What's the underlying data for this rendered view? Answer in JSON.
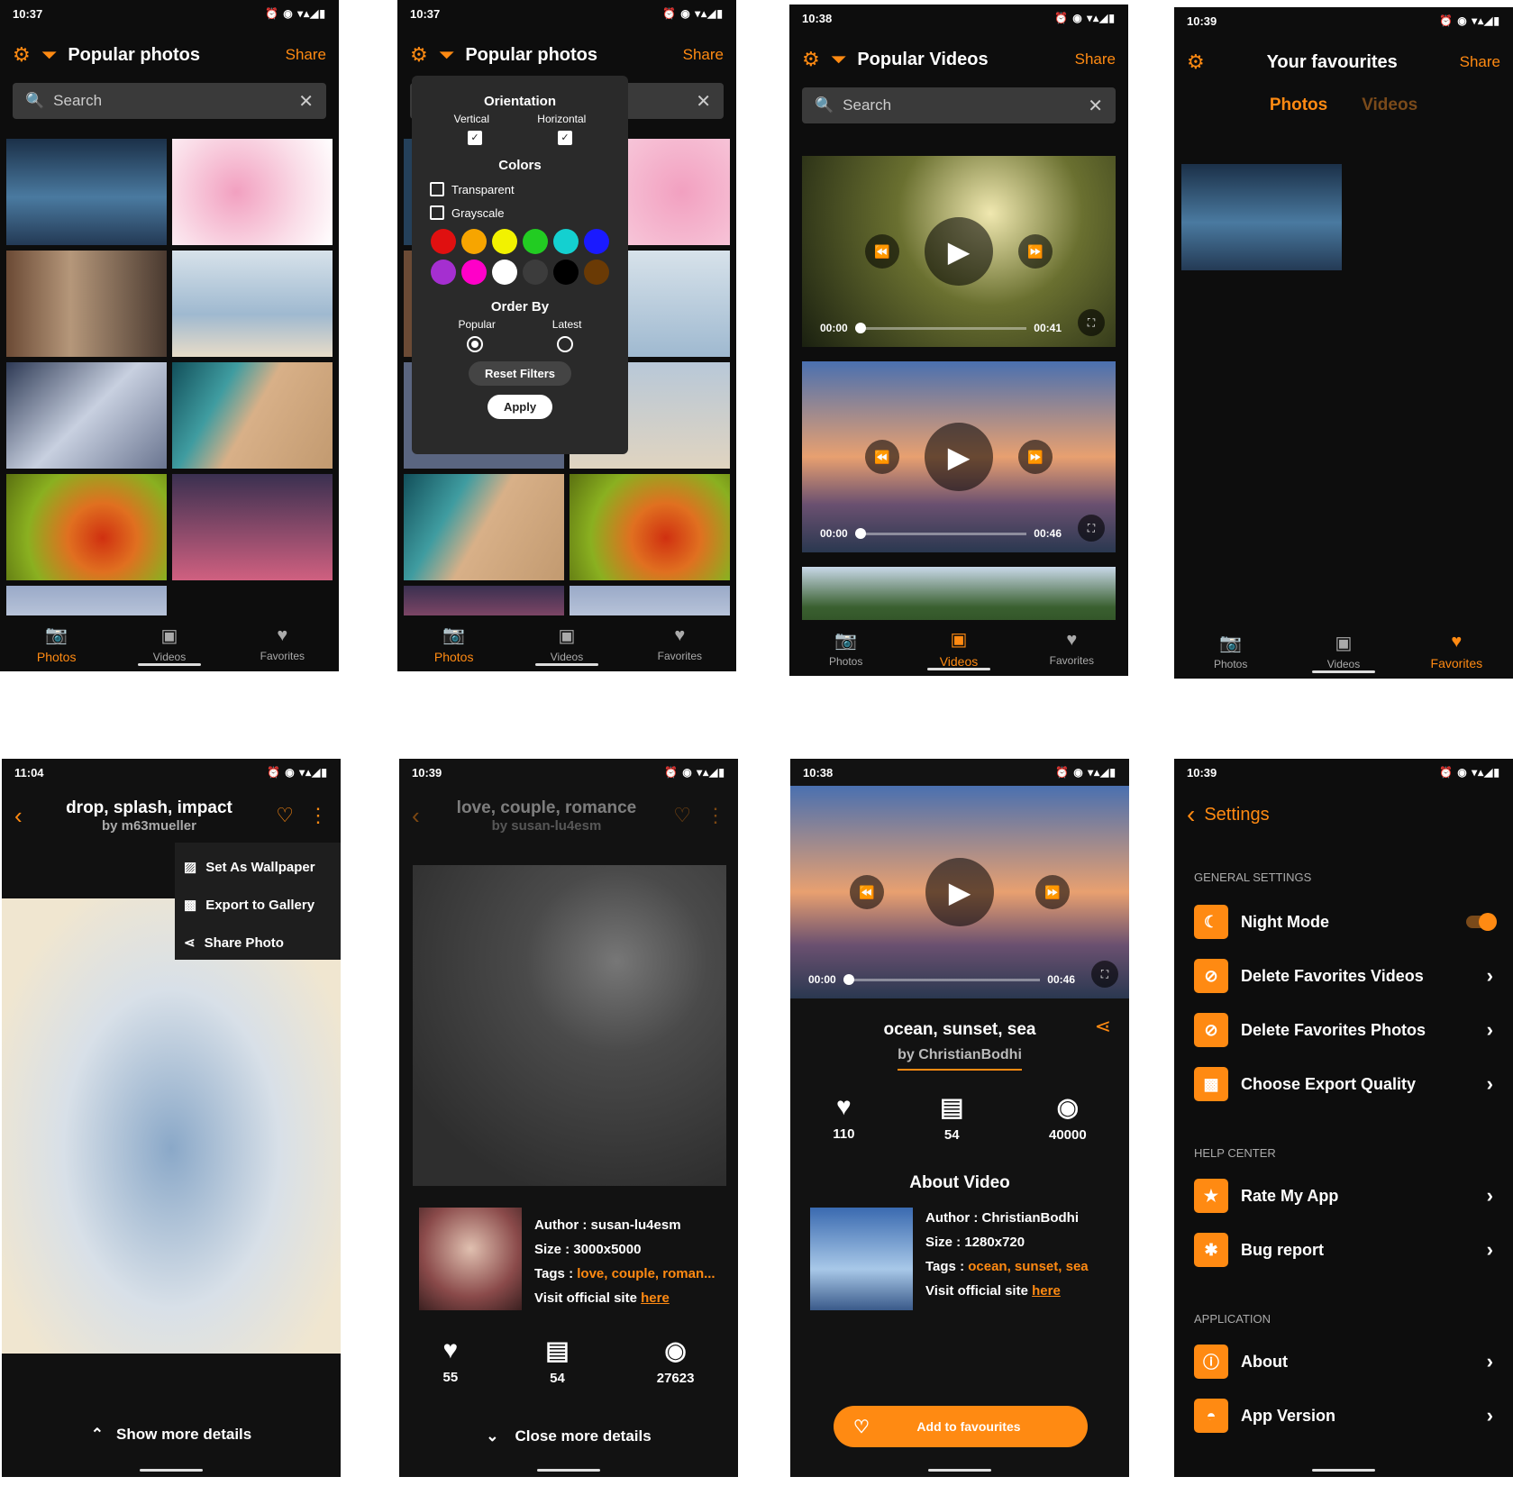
{
  "status": {
    "s1": "10:37",
    "s2": "10:37",
    "s3": "10:38",
    "s4": "10:39",
    "s5": "11:04",
    "s6": "10:39",
    "s7": "10:38",
    "s8": "10:39",
    "right": "⏰ ◉ ▾▴◢▮"
  },
  "colors": {
    "accent": "#ff8a12",
    "bg": "#0d0d0d"
  },
  "common": {
    "share": "Share",
    "search_placeholder": "Search"
  },
  "nav": {
    "photos": "Photos",
    "videos": "Videos",
    "favorites": "Favorites"
  },
  "screen1": {
    "title": "Popular photos"
  },
  "screen2": {
    "title": "Popular photos",
    "orientation": "Orientation",
    "vertical": "Vertical",
    "horizontal": "Horizontal",
    "colors_label": "Colors",
    "transparent": "Transparent",
    "grayscale": "Grayscale",
    "order_by": "Order By",
    "popular": "Popular",
    "latest": "Latest",
    "reset": "Reset Filters",
    "apply": "Apply",
    "swatches": [
      "#e01010",
      "#f7a500",
      "#f2f200",
      "#22cc22",
      "#14d0d0",
      "#1a1aff",
      "#a52fd0",
      "#ff00c8",
      "#ffffff",
      "#3c3c3c",
      "#000000",
      "#6a3a05"
    ]
  },
  "screen3": {
    "title": "Popular Videos",
    "videos": [
      {
        "start": "00:00",
        "end": "00:41"
      },
      {
        "start": "00:00",
        "end": "00:46"
      }
    ]
  },
  "screen4": {
    "title": "Your favourites",
    "tab_photos": "Photos",
    "tab_videos": "Videos"
  },
  "screen5": {
    "title": "drop, splash, impact",
    "subtitle": "by m63mueller",
    "menu": [
      "Set As Wallpaper",
      "Export to Gallery",
      "Share Photo"
    ],
    "more": "Show more details"
  },
  "screen6": {
    "title": "love, couple, romance",
    "subtitle": "by susan-lu4esm",
    "author_label": "Author : ",
    "author": "susan-lu4esm",
    "size_label": "Size : ",
    "size": "3000x5000",
    "tags_label": "Tags : ",
    "tags": "love, couple, roman...",
    "visit": "Visit official site ",
    "here": "here",
    "likes": "55",
    "comments": "54",
    "views": "27623",
    "close": "Close more details"
  },
  "screen7": {
    "start": "00:00",
    "end": "00:46",
    "title": "ocean, sunset, sea",
    "subtitle": "by ChristianBodhi",
    "likes": "110",
    "comments": "54",
    "views": "40000",
    "about": "About Video",
    "author_label": "Author : ",
    "author": "ChristianBodhi",
    "size_label": "Size : ",
    "size": "1280x720",
    "tags_label": "Tags : ",
    "tags": "ocean, sunset, sea",
    "visit": "Visit official site ",
    "here": "here",
    "add": "Add to favourites"
  },
  "screen8": {
    "title": "Settings",
    "general": "GENERAL SETTINGS",
    "night": "Night Mode",
    "del_videos": "Delete Favorites Videos",
    "del_photos": "Delete Favorites Photos",
    "export": "Choose Export Quality",
    "help": "HELP CENTER",
    "rate": "Rate My App",
    "bug": "Bug report",
    "application": "APPLICATION",
    "about": "About",
    "version": "App Version"
  }
}
